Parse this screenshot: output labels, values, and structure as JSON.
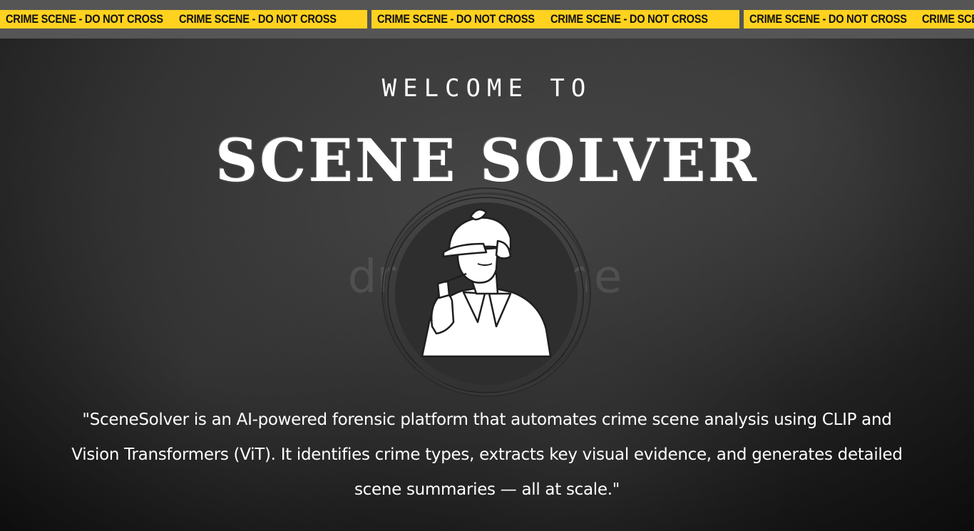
{
  "tape": {
    "text": "CRIME SCENE - DO NOT CROSS",
    "color": "#ffd21f",
    "segments": 5
  },
  "hero": {
    "welcome": "WELCOME TO",
    "title": "SCENE SOLVER",
    "watermark": "dreamstime",
    "emblem_icon": "detective-icon",
    "description": "\"SceneSolver is an AI-powered forensic platform that automates crime scene analysis using CLIP and Vision Transformers (ViT). It identifies crime types, extracts key visual evidence, and generates detailed scene summaries — all at scale.\""
  }
}
